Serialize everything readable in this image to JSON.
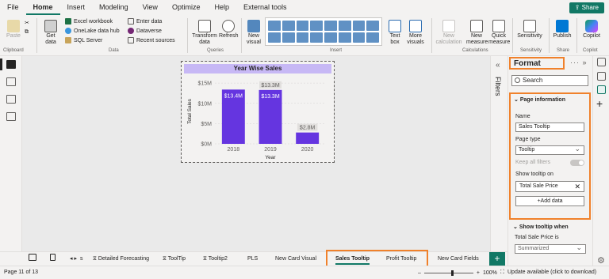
{
  "menu": {
    "items": [
      "File",
      "Home",
      "Insert",
      "Modeling",
      "View",
      "Optimize",
      "Help",
      "External tools"
    ],
    "active": "Home",
    "share_label": "Share"
  },
  "ribbon": {
    "clipboard": {
      "paste": "Paste",
      "group": "Clipboard"
    },
    "data": {
      "get_data": "Get data",
      "excel": "Excel workbook",
      "onelake": "OneLake data hub",
      "sql": "SQL Server",
      "enter": "Enter data",
      "dataverse": "Dataverse",
      "recent": "Recent sources",
      "group": "Data"
    },
    "queries": {
      "transform": "Transform data",
      "refresh": "Refresh",
      "group": "Queries"
    },
    "insert": {
      "new_visual": "New visual",
      "text_box": "Text box",
      "more_visuals": "More visuals",
      "group": "Insert"
    },
    "calculations": {
      "new_calc": "New calculation",
      "new_measure": "New measure",
      "quick_measure": "Quick measure",
      "group": "Calculations"
    },
    "sensitivity": {
      "label": "Sensitivity",
      "group": "Sensitivity"
    },
    "share": {
      "publish": "Publish",
      "group": "Share"
    },
    "copilot": {
      "label": "Copilot",
      "group": "Copilot"
    }
  },
  "visual": {
    "title": "Year Wise Sales",
    "title_bg": "#c7b8f5"
  },
  "chart_data": {
    "type": "bar",
    "title": "Year Wise Sales",
    "categories": [
      "2018",
      "2019",
      "2020"
    ],
    "values": [
      13.4,
      13.3,
      2.8
    ],
    "data_labels": [
      "$13.4M",
      "$13.3M",
      "$2.8M"
    ],
    "xlabel": "Year",
    "ylabel": "Total Sales",
    "yticks": [
      "$0M",
      "$5M",
      "$10M",
      "$15M"
    ],
    "ylim": [
      0,
      16
    ],
    "bar_color": "#6535e0",
    "grid": true
  },
  "filters": {
    "label": "Filters"
  },
  "format_pane": {
    "title": "Format",
    "controls": "···  »",
    "search_placeholder": "Search",
    "page_info": {
      "header": "Page information",
      "name_label": "Name",
      "name_value": "Sales Tooltip",
      "type_label": "Page type",
      "type_value": "Tooltip",
      "keep_filters": "Keep all filters",
      "show_on_label": "Show tooltip on",
      "show_on_value": "Total Sale Price",
      "add_data": "+Add data"
    },
    "show_when": {
      "header": "Show tooltip when",
      "field_label": "Total Sale Price is",
      "field_value": "Summarized"
    }
  },
  "tabs": {
    "items": [
      "s",
      "Detailed Forecasting",
      "ToolTip",
      "Tooltip2",
      "PLS",
      "New Card Visual",
      "Sales Tooltip",
      "Profit Tooltip",
      "New Card Fields"
    ],
    "active": "Sales Tooltip",
    "add": "+"
  },
  "status": {
    "page": "Page 11 of 13",
    "zoom": "100%",
    "update": "Update available (click to download)"
  },
  "colors": {
    "accent": "#117865",
    "highlight": "#f0812b"
  }
}
